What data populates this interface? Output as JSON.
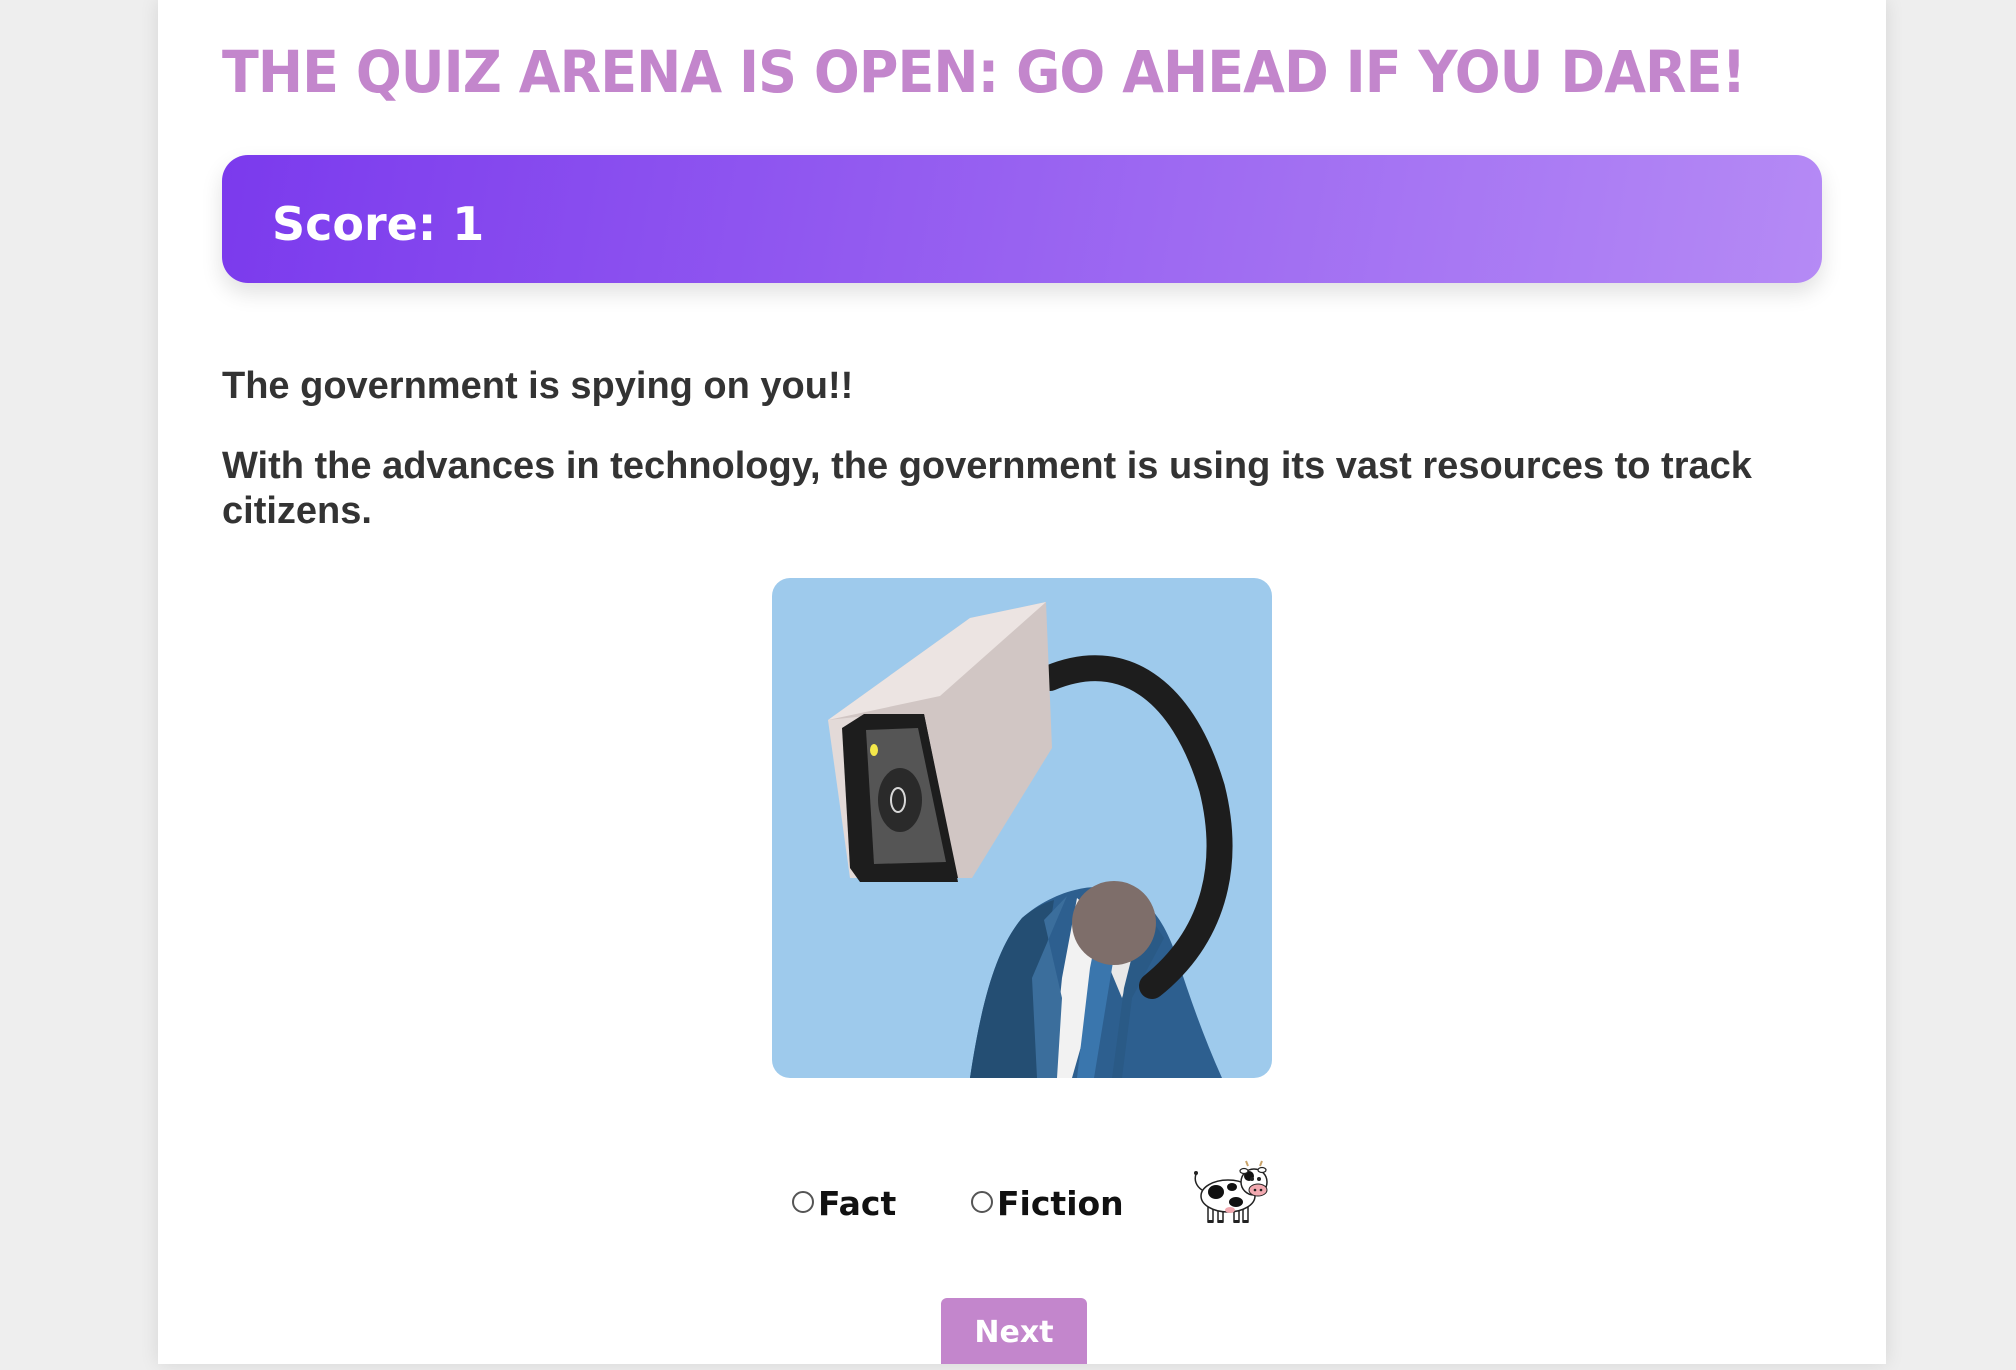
{
  "header": {
    "title": "The Quiz Arena is open: Go ahead if you dare!"
  },
  "score": {
    "label": "Score: 1",
    "gradient_start": "#7b3aed",
    "gradient_end": "#b58af5"
  },
  "question": {
    "headline": "The government is spying on you!!",
    "body": "With the advances in technology, the government is using its vast resources to track citizens."
  },
  "illustration": {
    "name": "surveillance-camera-head-illustration",
    "background": "#9ecaec"
  },
  "answers": {
    "options": [
      {
        "label": "Fact",
        "selected": false
      },
      {
        "label": "Fiction",
        "selected": false
      }
    ],
    "mascot_icon": "cow-icon"
  },
  "actions": {
    "next_label": "Next"
  },
  "colors": {
    "accent": "#c386cc",
    "text": "#333333",
    "page_background": "#eeeeee"
  }
}
